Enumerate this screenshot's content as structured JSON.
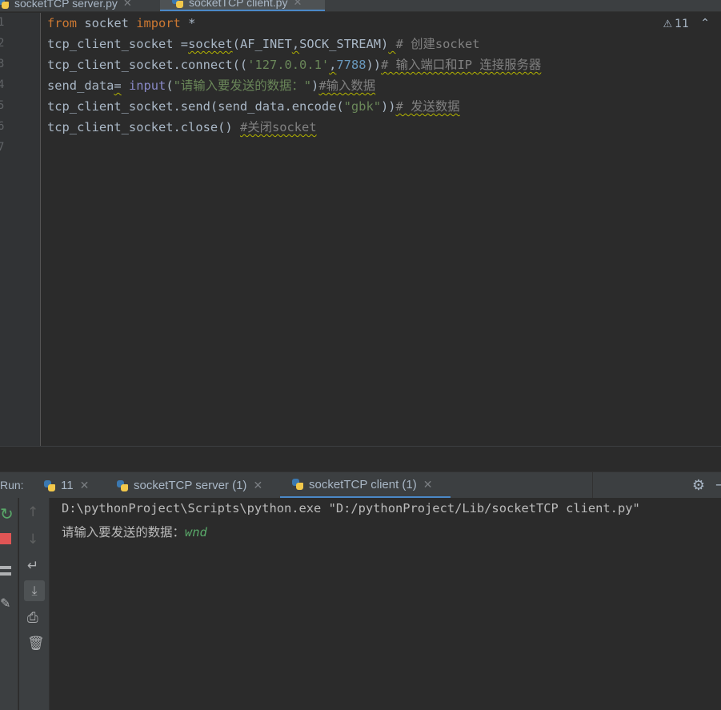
{
  "editor_tabs": [
    {
      "label": "socketTCP server.py",
      "active": false
    },
    {
      "label": "socketTCP client.py",
      "active": true
    }
  ],
  "line_numbers": [
    "1",
    "2",
    "3",
    "4",
    "5",
    "6",
    "7"
  ],
  "code": {
    "l1": {
      "kw1": "from",
      "mod": " socket ",
      "kw2": "import",
      "rest": " *"
    },
    "l2": {
      "a": "tcp_client_socket =",
      "fn": "socket",
      "b": "(AF_INET",
      "comma": ",",
      "c": "SOCK_STREAM)",
      "sp": " ",
      "comment": "# 创建socket"
    },
    "l3": {
      "a": "tcp_client_socket.connect((",
      "str": "'127.0.0.1'",
      "comma": ",",
      "num": "7788",
      "b": "))",
      "comment": "# 输入端口和IP 连接服务器"
    },
    "l4": {
      "a": "send_data",
      "eq": "=",
      "sp": " ",
      "bi": "input",
      "p1": "(",
      "str": "\"请输入要发送的数据：\"",
      "p2": ")",
      "comment": "#输入数据"
    },
    "l5": {
      "a": "tcp_client_socket.send(send_data.encode(",
      "str": "\"gbk\"",
      "b": "))",
      "comment": "# 发送数据"
    },
    "l6": {
      "a": "tcp_client_socket.close()",
      "sp": " ",
      "comment": "#关闭socket"
    }
  },
  "inspections": {
    "warning_count": "11"
  },
  "run": {
    "label": "Run:",
    "tabs": [
      {
        "label": "11"
      },
      {
        "label": "socketTCP server (1)"
      },
      {
        "label": "socketTCP client (1)"
      }
    ],
    "console": {
      "line1": "D:\\pythonProject\\Scripts\\python.exe \"D:/pythonProject/Lib/socketTCP client.py\"",
      "prompt": "请输入要发送的数据：",
      "input": "wnd"
    }
  },
  "colors": {
    "keyword": "#cc7832",
    "string": "#6a8759",
    "number": "#6897bb",
    "builtin": "#8888c6",
    "comment": "#808080",
    "accent": "#4a88c7"
  },
  "icons": [
    "python-file-icon",
    "close-icon",
    "warning-icon",
    "chevron-up-icon",
    "rerun-icon",
    "stop-icon",
    "layout-icon",
    "pin-icon",
    "arrow-up-icon",
    "arrow-down-icon",
    "soft-wrap-icon",
    "scroll-to-end-icon",
    "print-icon",
    "trash-icon",
    "gear-icon",
    "minimize-icon"
  ]
}
